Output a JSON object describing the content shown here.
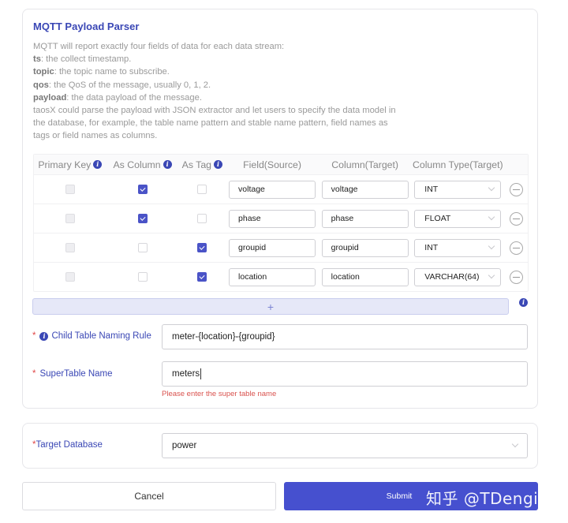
{
  "parser": {
    "title": "MQTT Payload Parser",
    "description": {
      "intro": "MQTT will report exactly four fields of data for each data stream:",
      "fields": [
        {
          "key": "ts",
          "text": ": the collect timestamp."
        },
        {
          "key": "topic",
          "text": ": the topic name to subscribe."
        },
        {
          "key": "qos",
          "text": ": the QoS of the message, usually 0, 1, 2."
        },
        {
          "key": "payload",
          "text": ": the data payload of the message."
        }
      ],
      "outro": "taosX could parse the payload with JSON extractor and let users to specify the data model in the database, for example, the table name pattern and stable name pattern, field names as tags or field names as columns."
    },
    "table": {
      "headers": [
        "Primary Key",
        "As Column",
        "As Tag",
        "Field(Source)",
        "Column(Target)",
        "Column Type(Target)"
      ],
      "rows": [
        {
          "primary_key": false,
          "as_column": true,
          "as_tag": false,
          "field_source": "voltage",
          "column_target": "voltage",
          "column_type": "INT"
        },
        {
          "primary_key": false,
          "as_column": true,
          "as_tag": false,
          "field_source": "phase",
          "column_target": "phase",
          "column_type": "FLOAT"
        },
        {
          "primary_key": false,
          "as_column": false,
          "as_tag": true,
          "field_source": "groupid",
          "column_target": "groupid",
          "column_type": "INT"
        },
        {
          "primary_key": false,
          "as_column": false,
          "as_tag": true,
          "field_source": "location",
          "column_target": "location",
          "column_type": "VARCHAR(64)"
        }
      ],
      "add_label": "+"
    },
    "child_table_rule": {
      "label": "Child Table Naming Rule",
      "required_mark": "*",
      "value": "meter-{location}-{groupid}"
    },
    "supertable": {
      "label": "SuperTable Name",
      "required_mark": "*",
      "value": "meters",
      "error": "Please enter the super table name"
    }
  },
  "target_db": {
    "label": "Target Database",
    "required_mark": "*",
    "value": "power"
  },
  "actions": {
    "cancel": "Cancel",
    "submit": "Submit"
  },
  "watermark": "知乎 @TDengine",
  "colors": {
    "accent": "#4650cf",
    "title": "#3a47b5",
    "error": "#d9534f"
  }
}
